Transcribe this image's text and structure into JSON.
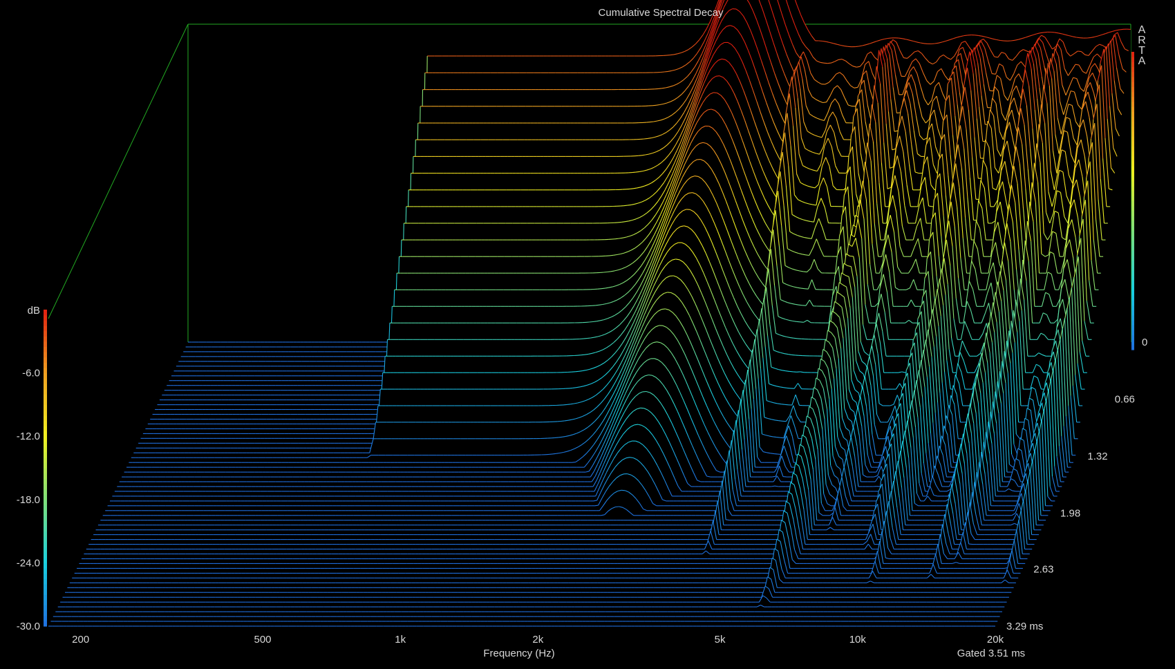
{
  "chart_data": {
    "type": "area",
    "title": "Cumulative Spectral Decay",
    "xlabel": "Frequency (Hz)",
    "ylabel": "dB",
    "zlabel_note": "Gated 3.51 ms",
    "brand": "ARTA",
    "x_scale": "log",
    "xlim": [
      170,
      20000
    ],
    "x_ticks": [
      {
        "value": 200,
        "label": "200"
      },
      {
        "value": 500,
        "label": "500"
      },
      {
        "value": 1000,
        "label": "1k"
      },
      {
        "value": 2000,
        "label": "2k"
      },
      {
        "value": 5000,
        "label": "5k"
      },
      {
        "value": 10000,
        "label": "10k"
      },
      {
        "value": 20000,
        "label": "20k"
      }
    ],
    "ylim": [
      -30,
      0
    ],
    "y_ticks": [
      "dB",
      "-6.0",
      "-12.0",
      "-18.0",
      "-24.0",
      "-30.0"
    ],
    "time_ticks": [
      {
        "value": 0,
        "label": "0"
      },
      {
        "value": 0.66,
        "label": "0.66"
      },
      {
        "value": 1.32,
        "label": "1.32"
      },
      {
        "value": 1.98,
        "label": "1.98"
      },
      {
        "value": 2.63,
        "label": "2.63"
      },
      {
        "value": 3.29,
        "label": "3.29 ms"
      }
    ],
    "time_range_ms": [
      0,
      3.29
    ],
    "slice_count": 60,
    "colormap": [
      "#1f6fe0",
      "#19d0e0",
      "#7ee07a",
      "#f0f020",
      "#f0a020",
      "#e02010"
    ],
    "axis_color": "#22aa22",
    "series_approx": [
      {
        "name": "0 ms",
        "freq": [
          600,
          800,
          1000,
          1500,
          2000,
          2500,
          3000,
          3500,
          4000,
          5000,
          7000,
          10000,
          15000,
          20000
        ],
        "db": [
          -18.5,
          -17,
          -15.5,
          -13,
          -11,
          -10,
          -5,
          -3,
          -2,
          -2,
          -1,
          -1,
          -0.5,
          -0.5
        ]
      },
      {
        "name": "0.66 ms",
        "freq": [
          600,
          1000,
          2000,
          3000,
          4000,
          5000,
          7000,
          10000,
          15000,
          20000
        ],
        "db": [
          -20,
          -20,
          -19,
          -10,
          -10,
          -20,
          -16,
          -17,
          -14,
          -16
        ]
      },
      {
        "name": "1.32 ms",
        "freq": [
          1500,
          2000,
          3000,
          4000,
          5000,
          7000,
          10000,
          15000,
          20000
        ],
        "db": [
          -30,
          -28,
          -18,
          -25,
          -29,
          -22,
          -24,
          -26,
          -28
        ]
      },
      {
        "name": "1.98 ms",
        "freq": [
          2500,
          3000,
          3500,
          5000,
          6000,
          8000,
          20000
        ],
        "db": [
          -30,
          -27,
          -29,
          -30,
          -27,
          -30,
          -30
        ]
      }
    ]
  }
}
